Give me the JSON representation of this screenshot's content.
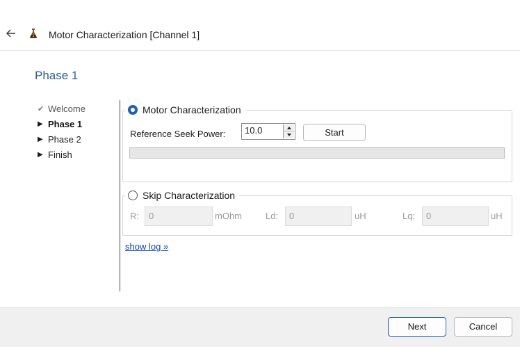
{
  "window": {
    "title": "Motor Characterization [Channel 1]",
    "back_icon": "arrow-left-icon",
    "app_icon": "flask-icon"
  },
  "page": {
    "title": "Phase 1"
  },
  "steps": [
    {
      "label": "Welcome",
      "state": "done"
    },
    {
      "label": "Phase 1",
      "state": "current"
    },
    {
      "label": "Phase 2",
      "state": "pending"
    },
    {
      "label": "Finish",
      "state": "pending"
    }
  ],
  "motor_group": {
    "radio_label": "Motor Characterization",
    "selected": true,
    "seek_label": "Reference Seek Power:",
    "seek_value": "10.0",
    "start_label": "Start",
    "progress": 0
  },
  "skip_group": {
    "radio_label": "Skip Characterization",
    "selected": false,
    "fields": [
      {
        "label": "R:",
        "value": "0",
        "unit": "mOhm"
      },
      {
        "label": "Ld:",
        "value": "0",
        "unit": "uH"
      },
      {
        "label": "Lq:",
        "value": "0",
        "unit": "uH"
      }
    ]
  },
  "show_log": "show log »",
  "footer": {
    "next_label": "Next",
    "cancel_label": "Cancel"
  },
  "colors": {
    "accent": "#1f5fb8",
    "page_title": "#2e5d9f",
    "link": "#0b3fbf"
  }
}
